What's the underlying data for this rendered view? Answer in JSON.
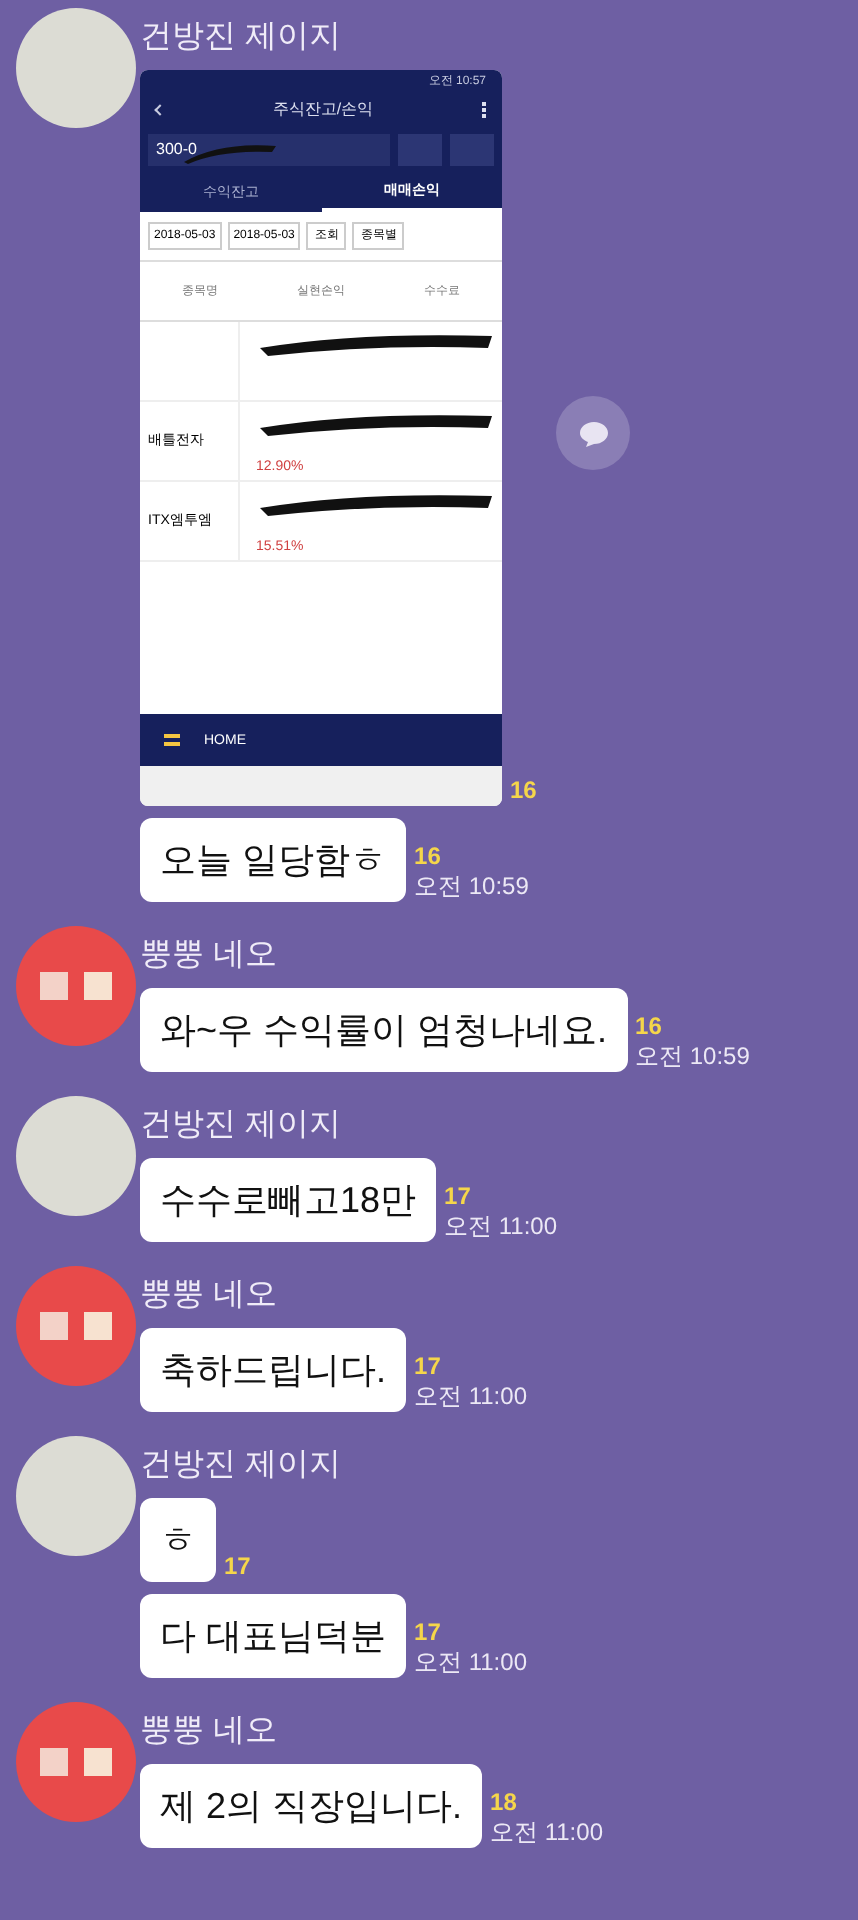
{
  "groups": [
    {
      "sender": "건방진 제이지",
      "color": "#dcdcd4",
      "messages": [
        {
          "kind": "image",
          "count": "16"
        },
        {
          "kind": "text",
          "text": "오늘 일당함ㅎ",
          "count": "16",
          "time": "오전 10:59"
        }
      ]
    },
    {
      "sender": "뿡뿡 네오",
      "color": "#e84a4a",
      "messages": [
        {
          "kind": "text",
          "text": "와~우 수익률이 엄청나네요.",
          "count": "16",
          "time": "오전 10:59"
        }
      ]
    },
    {
      "sender": "건방진 제이지",
      "color": "#dcdcd4",
      "messages": [
        {
          "kind": "text",
          "text": "수수로빼고18만",
          "count": "17",
          "time": "오전 11:00"
        }
      ]
    },
    {
      "sender": "뿡뿡 네오",
      "color": "#e84a4a",
      "messages": [
        {
          "kind": "text",
          "text": "축하드립니다.",
          "count": "17",
          "time": "오전 11:00"
        }
      ]
    },
    {
      "sender": "건방진 제이지",
      "color": "#dcdcd4",
      "messages": [
        {
          "kind": "text",
          "text": "ㅎ",
          "count": "17"
        },
        {
          "kind": "text",
          "text": "다 대표님덕분",
          "count": "17",
          "time": "오전 11:00"
        }
      ]
    },
    {
      "sender": "뿡뿡 네오",
      "color": "#e84a4a",
      "messages": [
        {
          "kind": "text",
          "text": "제 2의 직장입니다.",
          "count": "18",
          "time": "오전 11:00"
        }
      ]
    }
  ],
  "screenshot": {
    "status_time": "오전 10:57",
    "title": "주식잔고/손익",
    "account": "300-0",
    "tabs": [
      {
        "label": "수익잔고",
        "selected": false
      },
      {
        "label": "매매손익",
        "selected": true
      }
    ],
    "date_from": "2018-05-03",
    "date_to": "2018-05-03",
    "query_button": "조회",
    "filter": "종목별",
    "columns": [
      "종목명",
      "실현손익",
      "수수료"
    ],
    "rows": [
      {
        "name": "",
        "rate": ""
      },
      {
        "name": "배틀전자",
        "rate": "12.90%"
      },
      {
        "name": "ITX엠투엠",
        "rate": "15.51%"
      }
    ],
    "nav": [
      "HOME"
    ]
  }
}
